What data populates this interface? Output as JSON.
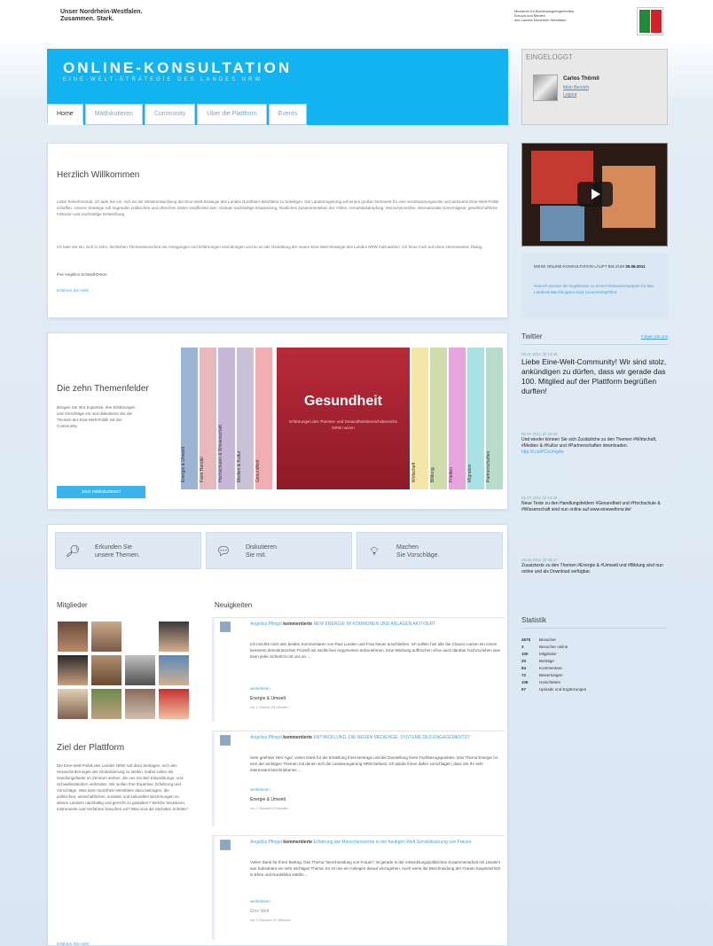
{
  "header": {
    "slogan_line1": "Unser Nordrhein-Westfalen.",
    "slogan_line2": "Zusammen. Stark.",
    "ministry_line1": "Ministerin für Bundesangelegenheiten,",
    "ministry_line2": "Europa und Medien",
    "ministry_line3": "des Landes Nordrhein-Westfalen"
  },
  "banner": {
    "title": "ONLINE-KONSULTATION",
    "subtitle": "EINE-WELT-STRATEGIE DES LANDES NRW",
    "color": "#12b3ee"
  },
  "tabs": [
    {
      "label": "Home",
      "active": true
    },
    {
      "label": "Mitdiskutieren",
      "active": false
    },
    {
      "label": "Community",
      "active": false
    },
    {
      "label": "Über die Plattform",
      "active": false
    },
    {
      "label": "Events",
      "active": false
    }
  ],
  "login": {
    "header": "EINGELOGGT",
    "name": "Carlos Thörnli",
    "link1": "Mein Bereich",
    "link2": "Logout"
  },
  "welcome": {
    "title": "Herzlich Willkommen",
    "text1": "Liebe Teilnehmende, ich lade Sie ein, sich an der Weiterentwicklung der Eine-Welt-Strategie des Landes Nordrhein-Westfalen zu beteiligen. Die Landesregierung will einem großen Netzwerk für eine verantwortungsvolle und wirksame Eine-Welt-Politik schaffen. Unsere Strategie soll tragenden politischen und ethischen Zielen verpflichtet sein: Globale nachhaltige Entwicklung, friedliches Zusammenleben der Völker, Armutsbekämpfung, Menschenrechte, internationale Gerechtigkeit, gesellschaftliche Inklusion und nachhaltige Entwicklung.",
    "text2": "Ich lade Sie ein, sich in zehn, fachlichen Themenbereichen mit Anregungen und Erfahrungen einzubringen und so an der Gestaltung der neuen Eine-Welt-Strategie des Landes NRW mitzuwirken. Ich freue mich auf einen interessanten Dialog.",
    "signature": "Ihre Angelica Schwall-Düren",
    "more": "Erfahren Sie mehr"
  },
  "themes": {
    "title": "Die zehn Themenfelder",
    "text": "Bringen Sie Ihre Expertise, Ihre Erfahrungen und Vorschläge ein und diskutieren Sie die Themen der Eine-Welt-Politik mit der Community.",
    "button": "Jetzt mitdiskutieren!",
    "books_left": [
      {
        "label": "Energie & Umwelt",
        "color": "#9cb3d4"
      },
      {
        "label": "Faire Handel",
        "color": "#e7b9bd"
      },
      {
        "label": "Hochschulen & Wissenschaft",
        "color": "#c8b8d8"
      },
      {
        "label": "Medien & Kultur",
        "color": "#c9c2d6"
      },
      {
        "label": "Gesundheit",
        "color": "#f0aeb2"
      }
    ],
    "feature_title": "Gesundheit",
    "feature_subtitle": "Erfahrungen des Themen- und Gesundheitsbereichsbereichs NRW nutzen",
    "books_right": [
      {
        "label": "Wirtschaft",
        "color": "#f4e6a8"
      },
      {
        "label": "Bildung",
        "color": "#cfdcab"
      },
      {
        "label": "Frieden",
        "color": "#e6a6dc"
      },
      {
        "label": "Migration",
        "color": "#a8e2e6"
      },
      {
        "label": "Partnerschaften",
        "color": "#b7dccb"
      }
    ]
  },
  "actions": [
    {
      "icon": "magnifier",
      "line1": "Erkunden Sie",
      "line2": "unsere Themen."
    },
    {
      "icon": "speech-bubbles",
      "line1": "Diskutieren",
      "line2": "Sie mit."
    },
    {
      "icon": "lightbulb",
      "line1": "Machen",
      "line2": "Sie Vorschläge."
    }
  ],
  "members": {
    "title": "Mitglieder"
  },
  "goal": {
    "title": "Ziel der Plattform",
    "text": "Die Eine-Welt-Politik des Landes NRW soll dazu beitragen, sich den Herausforderungen der Globalisierung zu stellen. Dabei sollen die Handlungsfelder im Zentrum stehen, die uns mit den Entwicklungs- und Schwellenländern verbinden. Wir wollen Ihre Expertise, Erfahrung und Vorschläge. Was kann Nordrhein-Westfalen dazu beitragen, die politischen, wirtschaftlichen, sozialen und kulturellen Beziehungen zu diesen Ländern nachhaltig und gerecht zu gestalten? Welche Strukturen, Instrumente und Verfahren brauchen wir? Was sind die nächsten Schritte?",
    "more": "Erfahren Sie mehr"
  },
  "news": {
    "title": "Neuigkeiten",
    "items": [
      {
        "author": "Angelica Pfingst",
        "verb": "kommentierte",
        "headline": "NEW ENERGIE IM KOMMUNEN UND ANLAGEN AKTIVIERT",
        "body": "Ich möchte mich den beiden Kommentaren von Paul Lunden und Frau Neuer anschließen. Ich sollten hier alle die Chance nutzen ein einem besseren demokratischen Prozeß mit sachlichen Argumenten teilzunehmen. Eine Werbung auffrischen ohne auch darüber hochzuziehen was kann jeder sicherlich mit uns an ...",
        "more": "weiterlesen",
        "category": "Energie & Umwelt",
        "time": "vor 1 Stunde 25 Minuten"
      },
      {
        "author": "Angelica Pfingst",
        "verb": "kommentierte",
        "headline": "ENTWICKLUNG: DIE NEUEN MEDIENGE. SYSTEME DES ENGAGEMENTS?",
        "body": "Sehr geehrter Herr Agor, vielen Dank für die Erstellung Ihres Beitrags und die Darstellung Ihres Fachbezugspunktes. Das Thema Energie ist eins der wichtigen Themen mit denen sich die Landesregierung NRW befasst. Ich würde Ihnen daher vorschlagen, dass Sie Ihr sehr interessant beschriebenes ...",
        "more": "weiterlesen",
        "category": "Energie & Umwelt",
        "time": "vor 2 Stunden 3 Minuten"
      },
      {
        "author": "Angelica Pfingst",
        "verb": "kommentierte",
        "headline": "Erfahrung der Menschenrechte in der heutigen Welt-Sensibilisierung von Frauen",
        "body": "Vielen Dank für Ihren Beitrag. Das Thema \"Beschneidung von Frauen\" ist gerade in der entwicklungspolitischen Zusammenarbeit mit Ländern aus Subsahara ein sehr wichtiges Thema. Es ist uns ein Anliegen darauf einzugehen. Auch wenn die Beschneidung der Frauen hauptsächlich in Ehen und Nordafrika stattfin ...",
        "more": "weiterlesen",
        "category": "Eine Welt",
        "time": "vor 2 Stunden 22 Minuten"
      }
    ]
  },
  "video": {
    "label": "video-player"
  },
  "notice": {
    "line1": "DIESE ONLINE-KONSULTATION LÄUFT BIS ZUM",
    "date": "30.06.2011",
    "line2": "Danach werden die Ergebnisse zu einem Diskussionspapier für das Landesentwicklungskonzept zusammengeführt."
  },
  "twitter": {
    "title": "Twitter",
    "follow": "Folgen Sie uns",
    "tweets": [
      {
        "date": "05.07.2011 @ 14:58",
        "text": "Liebe Eine-Welt-Community! Wir sind stolz, ankündigen zu dürfen, dass wir gerade das 100. Mitglied auf der Plattform begrüßen durften!",
        "big": true
      },
      {
        "date": "05.07.2011 @ 15:00",
        "text": "Und wieder können Sie sich Zusätzliche zu den Themen #Wirtschaft, #Medien & #Kultur und #Partnerschaften downloaden.",
        "link": "http://t.co/PCxUmgAx",
        "big": false
      },
      {
        "date": "01.07.2011 @ 13:25",
        "text": "Neue Texte zu den Handlungsfeldern #Gesundheit und #Hochschule & #Wissenschaft sind nun online auf www.eineweltnrw.de/",
        "big": false
      },
      {
        "date": "29.06.2011 @ 09:47",
        "text": "Zusatztexte zu den Themen #Energie & #Umwelt und #Bildung sind nun online und als Download verfügbar.",
        "big": false
      }
    ]
  },
  "stats": {
    "title": "Statistik",
    "rows": [
      {
        "n": "4678",
        "label": "Besucher"
      },
      {
        "n": "3",
        "label": "Besucher online"
      },
      {
        "n": "100",
        "label": "Mitglieder"
      },
      {
        "n": "20",
        "label": "Beiträge"
      },
      {
        "n": "84",
        "label": "Kommentare"
      },
      {
        "n": "72",
        "label": "Bewertungen"
      },
      {
        "n": "108",
        "label": "Gesichteten"
      },
      {
        "n": "97",
        "label": "Uploads und Ergänzungen"
      }
    ]
  }
}
